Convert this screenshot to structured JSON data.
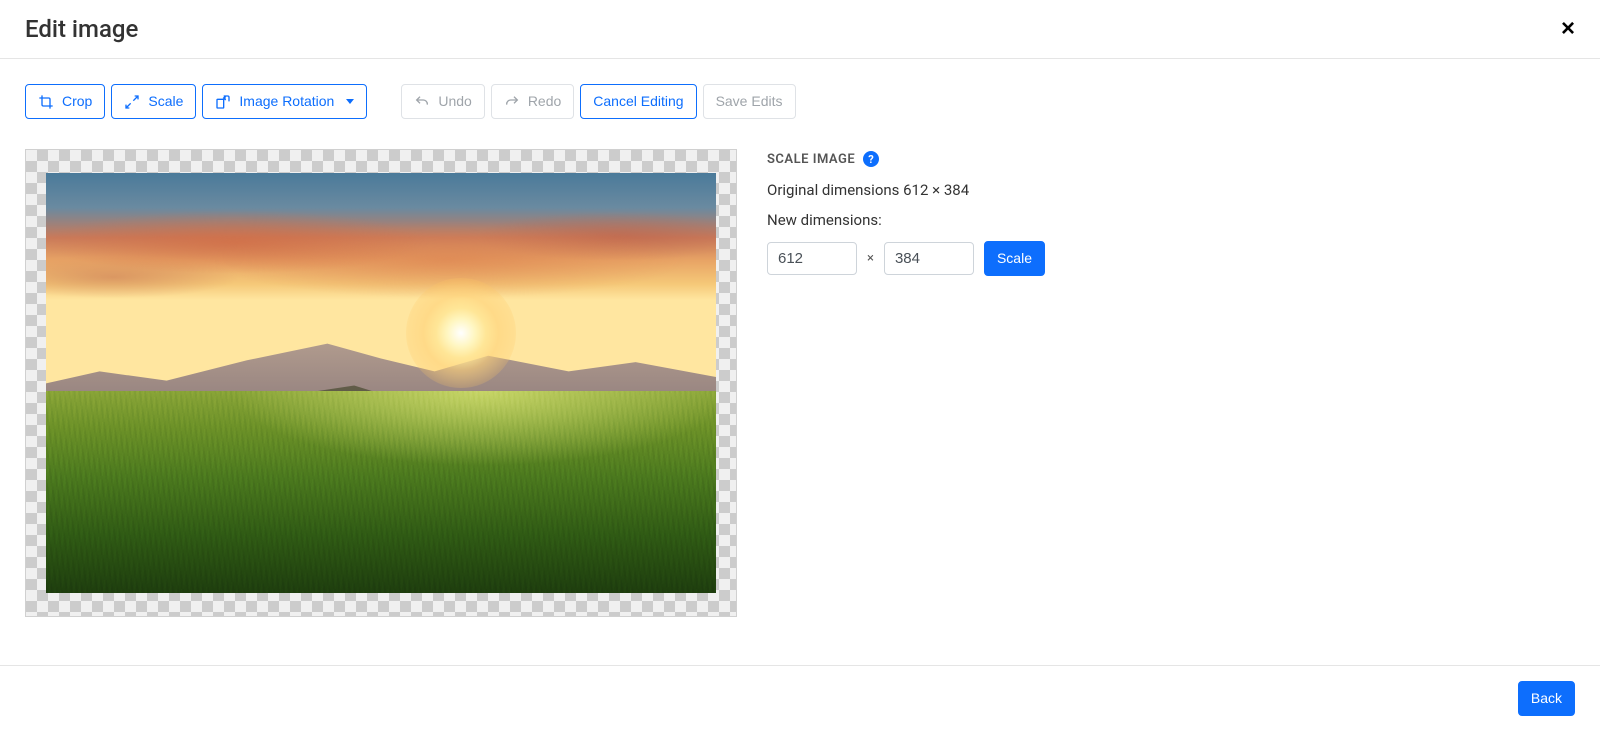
{
  "modal": {
    "title": "Edit image",
    "close_label": "×"
  },
  "toolbar": {
    "crop": "Crop",
    "scale": "Scale",
    "rotation": "Image Rotation",
    "undo": "Undo",
    "redo": "Redo",
    "cancel": "Cancel Editing",
    "save": "Save Edits"
  },
  "scale_panel": {
    "title": "SCALE IMAGE",
    "help": "?",
    "original_label": "Original dimensions 612 × 384",
    "new_label": "New dimensions:",
    "width_value": "612",
    "height_value": "384",
    "times": "×",
    "scale_button": "Scale"
  },
  "footer": {
    "back": "Back"
  }
}
